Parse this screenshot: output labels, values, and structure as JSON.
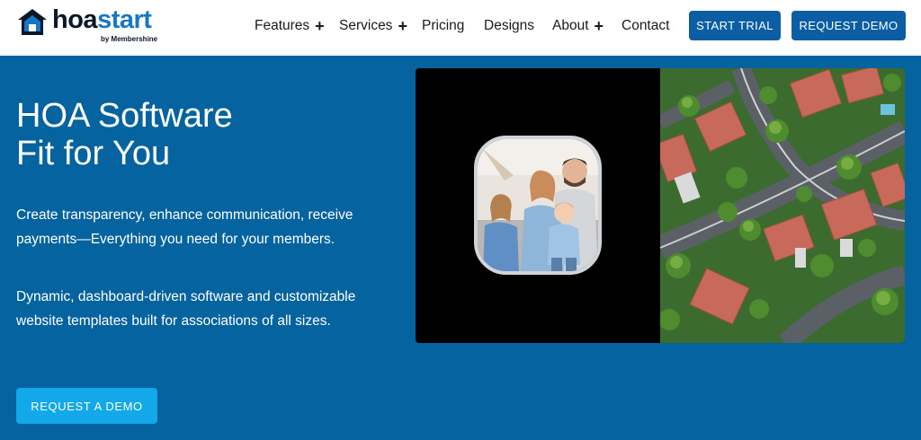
{
  "brand": {
    "name_part1": "hoa",
    "name_part2": "start",
    "tagline": "by Membershine",
    "colors": {
      "dark": "#0b1626",
      "accent": "#1677c6"
    }
  },
  "nav": {
    "items": [
      {
        "label": "Features",
        "has_submenu": true
      },
      {
        "label": "Services",
        "has_submenu": true
      },
      {
        "label": "Pricing",
        "has_submenu": false
      },
      {
        "label": "Designs",
        "has_submenu": false
      },
      {
        "label": "About",
        "has_submenu": true
      },
      {
        "label": "Contact",
        "has_submenu": false
      }
    ],
    "submenu_glyph": "+",
    "start_trial": "START TRIAL",
    "request_demo": "REQUEST DEMO"
  },
  "hero": {
    "title_line1": "HOA Software",
    "title_line2": "Fit for You",
    "paragraph1": "Create transparency, enhance communication, receive payments—Everything you need for your members.",
    "paragraph2": "Dynamic, dashboard-driven software and customizable website templates built for associations of all sizes.",
    "cta": "REQUEST A DEMO",
    "colors": {
      "background": "#05639f",
      "cta": "#12a8ea",
      "header_button": "#0b5ea3"
    }
  },
  "media": {
    "left_image": "family-photo",
    "right_image": "neighborhood-aerial-photo"
  }
}
